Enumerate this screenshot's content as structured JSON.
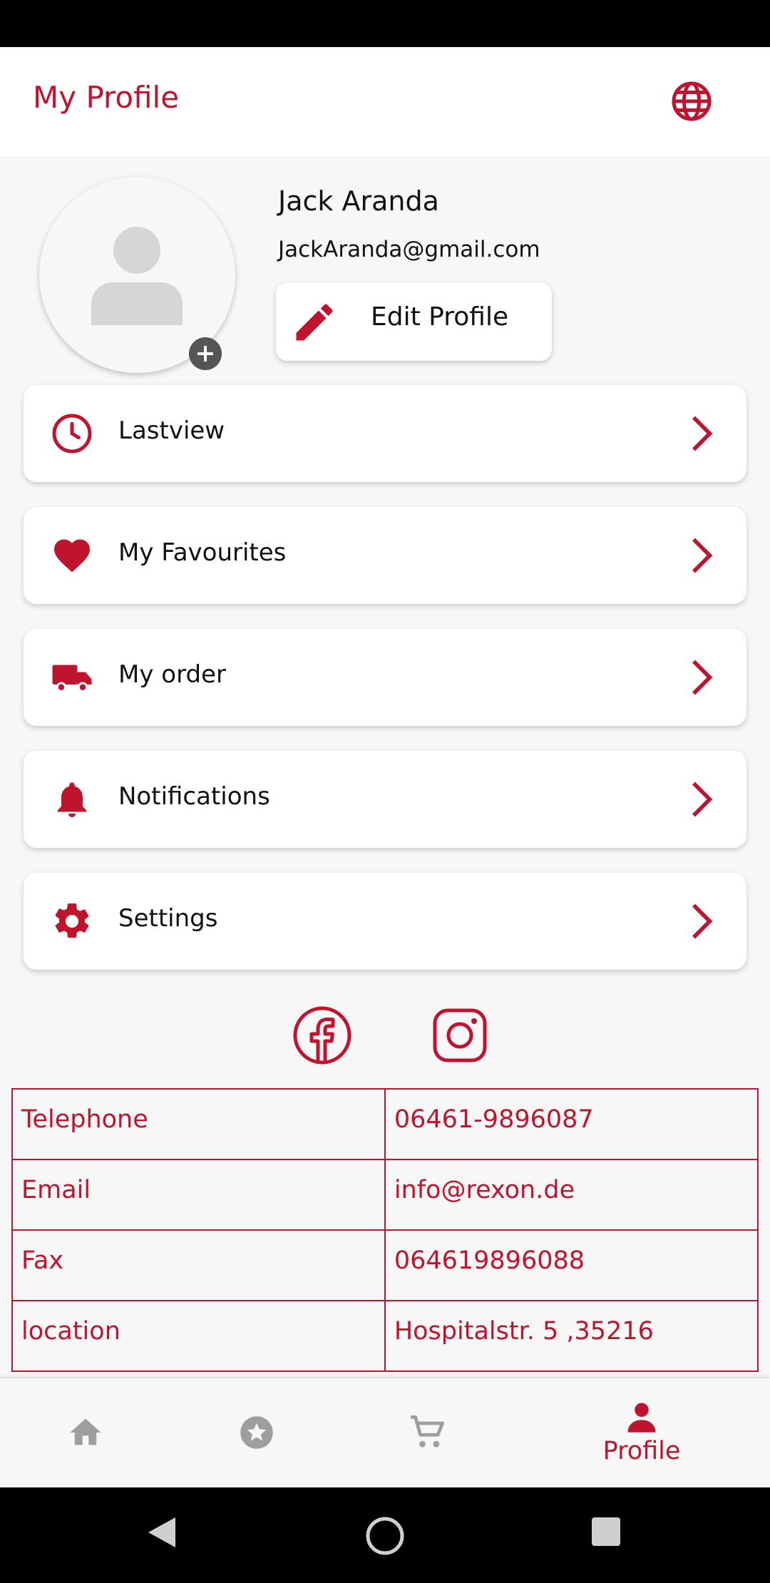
{
  "app_bar": {
    "title": "My Profile"
  },
  "profile": {
    "name": "Jack Aranda",
    "email": "JackAranda@gmail.com",
    "edit_label": "Edit Profile"
  },
  "menu": [
    {
      "label": "Lastview",
      "icon": "clock-icon"
    },
    {
      "label": "My Favourites",
      "icon": "heart-icon"
    },
    {
      "label": "My order",
      "icon": "truck-icon"
    },
    {
      "label": "Notifications",
      "icon": "bell-icon"
    },
    {
      "label": "Settings",
      "icon": "gear-icon"
    }
  ],
  "contact": [
    {
      "key": "Telephone",
      "value": "06461-9896087"
    },
    {
      "key": "Email",
      "value": "info@rexon.de"
    },
    {
      "key": "Fax",
      "value": "064619896088"
    },
    {
      "key": "location",
      "value": "Hospitalstr. 5 ,35216"
    }
  ],
  "bottom_nav": {
    "active_label": "Profile"
  },
  "colors": {
    "accent": "#c0142e",
    "background": "#f7f7f7",
    "icon_gray": "#9e9e9e"
  }
}
